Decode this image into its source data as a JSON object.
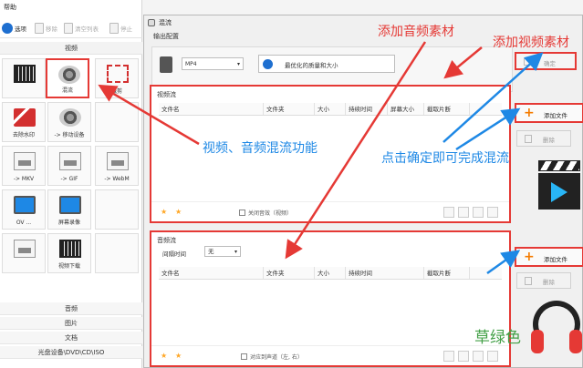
{
  "menubar": {
    "help": "帮助"
  },
  "toolbar": {
    "options": "选项",
    "remove": "移除",
    "clear_list": "清空列表",
    "start": "停止"
  },
  "left": {
    "category_video": "视频",
    "tiles": [
      {
        "label": "",
        "icon": "film-icon"
      },
      {
        "label": "混流",
        "icon": "mix-icon"
      },
      {
        "label": "裁剪",
        "icon": "crop-icon"
      },
      {
        "label": "去除水印",
        "icon": "watermark-icon"
      },
      {
        "label": "-> 移动设备",
        "icon": "mobile-icon"
      },
      {
        "label": "",
        "icon": "blank"
      },
      {
        "label": "-> MKV",
        "icon": "mkv-icon"
      },
      {
        "label": "-> GIF",
        "icon": "gif-icon"
      },
      {
        "label": "-> WebM",
        "icon": "webm-icon"
      },
      {
        "label": "OV ...",
        "icon": "ov-icon"
      },
      {
        "label": "屏幕录像",
        "icon": "screen-record-icon"
      },
      {
        "label": "",
        "icon": "blank"
      },
      {
        "label": "",
        "icon": "doc-icon"
      },
      {
        "label": "视频下载",
        "icon": "download-icon"
      },
      {
        "label": "",
        "icon": "blank"
      }
    ],
    "categories": [
      "音频",
      "图片",
      "文档",
      "光盘设备\\DVD\\CD\\ISO"
    ]
  },
  "dialog": {
    "title": "混流",
    "output_label": "输出配置",
    "format": "MP4",
    "quality": "最优化的质量和大小",
    "confirm": "确定",
    "video": {
      "title": "视频流",
      "columns": [
        "文件名",
        "文件夹",
        "大小",
        "持续时间",
        "屏幕大小",
        "截取片断"
      ],
      "mute_label": "关闭音效（视频）"
    },
    "audio": {
      "title": "音频流",
      "interval_label": "间隔时间",
      "interval_value": "无",
      "columns": [
        "文件名",
        "文件夹",
        "大小",
        "持续时间",
        "截取片断"
      ],
      "align_label": "对应到声道（左, 右）"
    },
    "add_file": "添加文件",
    "delete": "删除"
  },
  "annotations": {
    "add_audio": "添加音频素材",
    "add_video": "添加视频素材",
    "mix_feature": "视频、音频混流功能",
    "confirm_hint": "点击确定即可完成混流",
    "brand": "草绿色"
  },
  "colors": {
    "highlight": "#e53935",
    "annotation_blue": "#1e88e5",
    "brand_green": "#43a047"
  }
}
